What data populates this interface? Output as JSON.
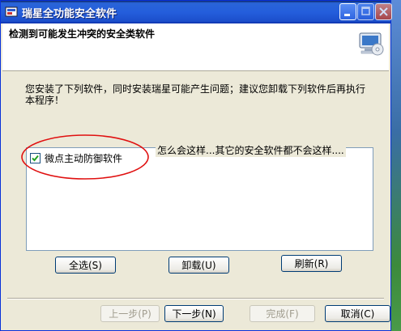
{
  "window": {
    "title": "瑞星全功能安全软件"
  },
  "header": {
    "title": "检测到可能发生冲突的安全类软件"
  },
  "main": {
    "instructions": "您安装了下列软件，同时安装瑞星可能产生问题；建议您卸载下列软件后再执行本程序！",
    "note": "怎么会这样...其它的安全软件都不会这样....",
    "list": [
      {
        "label": "微点主动防御软件",
        "checked": true
      }
    ],
    "select_all_label": "全选(S)",
    "uninstall_label": "卸载(U)",
    "refresh_label": "刷新(R)"
  },
  "footer": {
    "back_label": "上一步(P)",
    "next_label": "下一步(N)",
    "finish_label": "完成(F)",
    "cancel_label": "取消(C)"
  },
  "colors": {
    "titlebar": "#245edc",
    "annotation": "#e01010",
    "frame": "#ece9d8"
  }
}
